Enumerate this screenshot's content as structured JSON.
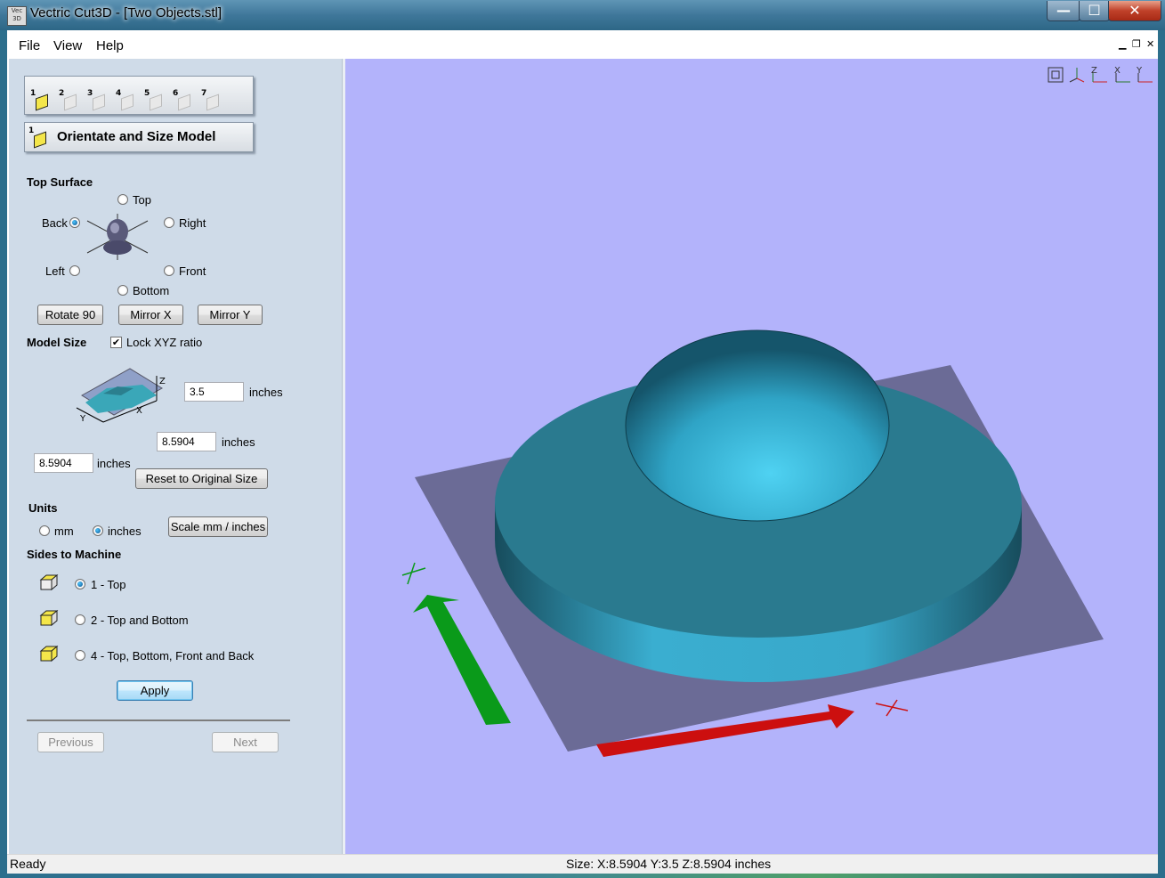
{
  "window": {
    "title": "Vectric Cut3D - [Two Objects.stl]",
    "icon_text": "Vec 3D",
    "minimize_glyph": "—",
    "maximize_glyph": "☐",
    "close_glyph": "✕"
  },
  "menu": {
    "items": [
      {
        "label": "File"
      },
      {
        "label": "View"
      },
      {
        "label": "Help"
      }
    ],
    "mdi_min": "▁",
    "mdi_restore": "❐",
    "mdi_close": "✕"
  },
  "toolbar": {
    "steps": [
      "1",
      "2",
      "3",
      "4",
      "5",
      "6",
      "7"
    ],
    "current_step_num": "1",
    "current_step_title": "Orientate and Size Model"
  },
  "top_surface": {
    "heading": "Top Surface",
    "options": {
      "top": "Top",
      "back": "Back",
      "right": "Right",
      "left": "Left",
      "front": "Front",
      "bottom": "Bottom"
    },
    "selected": "back",
    "buttons": {
      "rotate": "Rotate 90",
      "mirror_x": "Mirror X",
      "mirror_y": "Mirror Y"
    }
  },
  "model_size": {
    "heading": "Model Size",
    "lock_label": "Lock XYZ ratio",
    "lock_checked": true,
    "z_value": "3.5",
    "x_value": "8.5904",
    "y_value": "8.5904",
    "unit": "inches",
    "axis_labels": {
      "x": "X",
      "y": "Y",
      "z": "Z"
    },
    "reset_label": "Reset to Original Size"
  },
  "units": {
    "heading": "Units",
    "mm_label": "mm",
    "inches_label": "inches",
    "selected": "inches",
    "scale_label": "Scale mm / inches"
  },
  "sides": {
    "heading": "Sides to Machine",
    "options": [
      {
        "label": "1 - Top",
        "selected": true
      },
      {
        "label": "2 - Top and Bottom",
        "selected": false
      },
      {
        "label": "4 - Top, Bottom, Front and Back",
        "selected": false
      }
    ],
    "apply_label": "Apply"
  },
  "nav": {
    "previous_label": "Previous",
    "next_label": "Next"
  },
  "viewport": {
    "background": "#b3b3fb",
    "view_icons": [
      "fit-view-icon",
      "iso-view-icon",
      "z-view-icon",
      "x-view-icon",
      "y-view-icon"
    ],
    "view_icon_labels": [
      "",
      "",
      "Z",
      "X",
      "Y"
    ],
    "x_axis_label": "X",
    "y_axis_label": "Y"
  },
  "status": {
    "left": "Ready",
    "center": "Size: X:8.5904 Y:3.5 Z:8.5904 inches"
  }
}
